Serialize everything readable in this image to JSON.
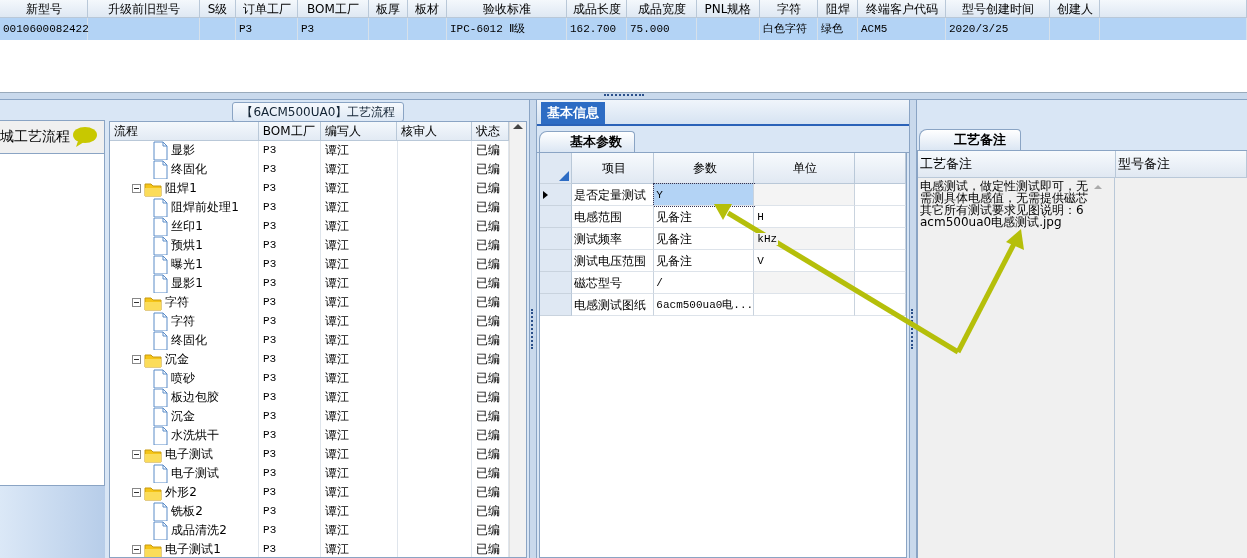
{
  "top_grid": {
    "columns": [
      {
        "header": "新型号",
        "value": "0010600082422"
      },
      {
        "header": "升级前旧型号"
      },
      {
        "header": "S级"
      },
      {
        "header": "订单工厂",
        "value": "P3"
      },
      {
        "header": "BOM工厂",
        "value": "P3"
      },
      {
        "header": "板厚"
      },
      {
        "header": "板材"
      },
      {
        "header": "验收标准",
        "value": "IPC-6012 Ⅱ级"
      },
      {
        "header": "成品长度",
        "value": "162.700"
      },
      {
        "header": "成品宽度",
        "value": "75.000"
      },
      {
        "header": "PNL规格"
      },
      {
        "header": "字符",
        "value": "白色字符"
      },
      {
        "header": "阻焊",
        "value": "绿色"
      },
      {
        "header": "终端客户代码",
        "value": "ACM5"
      },
      {
        "header": "型号创建时间",
        "value": "2020/3/25"
      },
      {
        "header": "创建人"
      }
    ],
    "row_selected": true
  },
  "left_panel": {
    "title": "城工艺流程"
  },
  "flow": {
    "title": "【6ACM500UA0】工艺流程",
    "columns": [
      "流程",
      "BOM工厂",
      "编写人",
      "核审人",
      "状态"
    ],
    "rows": [
      {
        "kind": "file",
        "name": "显影",
        "bom": "P3",
        "writer": "谭江",
        "status": "已编"
      },
      {
        "kind": "file",
        "name": "终固化",
        "bom": "P3",
        "writer": "谭江",
        "status": "已编"
      },
      {
        "kind": "folder",
        "name": "阻焊1",
        "bom": "P3",
        "writer": "谭江",
        "status": "已编",
        "expanded": true,
        "children": [
          {
            "kind": "file",
            "name": "阻焊前处理1",
            "bom": "P3",
            "writer": "谭江",
            "status": "已编"
          },
          {
            "kind": "file",
            "name": "丝印1",
            "bom": "P3",
            "writer": "谭江",
            "status": "已编"
          },
          {
            "kind": "file",
            "name": "预烘1",
            "bom": "P3",
            "writer": "谭江",
            "status": "已编"
          },
          {
            "kind": "file",
            "name": "曝光1",
            "bom": "P3",
            "writer": "谭江",
            "status": "已编"
          },
          {
            "kind": "file",
            "name": "显影1",
            "bom": "P3",
            "writer": "谭江",
            "status": "已编"
          }
        ]
      },
      {
        "kind": "folder",
        "name": "字符",
        "bom": "P3",
        "writer": "谭江",
        "status": "已编",
        "expanded": true,
        "children": [
          {
            "kind": "file",
            "name": "字符",
            "bom": "P3",
            "writer": "谭江",
            "status": "已编"
          },
          {
            "kind": "file",
            "name": "终固化",
            "bom": "P3",
            "writer": "谭江",
            "status": "已编"
          }
        ]
      },
      {
        "kind": "folder",
        "name": "沉金",
        "bom": "P3",
        "writer": "谭江",
        "status": "已编",
        "expanded": true,
        "children": [
          {
            "kind": "file",
            "name": "喷砂",
            "bom": "P3",
            "writer": "谭江",
            "status": "已编"
          },
          {
            "kind": "file",
            "name": "板边包胶",
            "bom": "P3",
            "writer": "谭江",
            "status": "已编"
          },
          {
            "kind": "file",
            "name": "沉金",
            "bom": "P3",
            "writer": "谭江",
            "status": "已编"
          },
          {
            "kind": "file",
            "name": "水洗烘干",
            "bom": "P3",
            "writer": "谭江",
            "status": "已编"
          }
        ]
      },
      {
        "kind": "folder",
        "name": "电子测试",
        "bom": "P3",
        "writer": "谭江",
        "status": "已编",
        "expanded": true,
        "children": [
          {
            "kind": "file",
            "name": "电子测试",
            "bom": "P3",
            "writer": "谭江",
            "status": "已编"
          }
        ]
      },
      {
        "kind": "folder",
        "name": "外形2",
        "bom": "P3",
        "writer": "谭江",
        "status": "已编",
        "expanded": true,
        "children": [
          {
            "kind": "file",
            "name": "铣板2",
            "bom": "P3",
            "writer": "谭江",
            "status": "已编"
          },
          {
            "kind": "file",
            "name": "成品清洗2",
            "bom": "P3",
            "writer": "谭江",
            "status": "已编"
          }
        ]
      },
      {
        "kind": "folder",
        "name": "电子测试1",
        "bom": "P3",
        "writer": "谭江",
        "status": "已编",
        "expanded": true
      }
    ]
  },
  "info": {
    "tab": {
      "label": "基本信息",
      "selected": true
    },
    "subtab": {
      "label": "基本参数",
      "selected": true
    },
    "columns": [
      "项目",
      "参数",
      "单位"
    ],
    "rows": [
      {
        "item": "是否定量测试",
        "param": "Y",
        "selected": true
      },
      {
        "item": "电感范围",
        "param": "见备注",
        "unit": "H",
        "selected": false
      },
      {
        "item": "测试频率",
        "param": "见备注",
        "unit": "kHz",
        "selected": false
      },
      {
        "item": "测试电压范围",
        "param": "见备注",
        "unit": "V",
        "selected": false
      },
      {
        "item": "磁芯型号",
        "param": "/",
        "selected": false
      },
      {
        "item": "电感测试图纸",
        "param": "6acm500ua0电...",
        "selected": false
      }
    ]
  },
  "remarks": {
    "tab": {
      "label": "工艺备注",
      "selected": true
    },
    "columns": [
      "工艺备注",
      "型号备注"
    ],
    "process_note": "电感测试，做定性测试即可，无需测具体电感值，无需提供磁芯其它所有测试要求见图说明：6acm500ua0电感测试.jpg"
  }
}
